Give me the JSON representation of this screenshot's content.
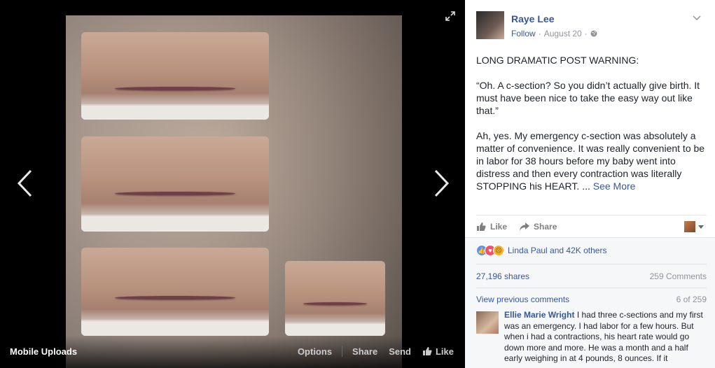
{
  "viewer": {
    "album_name": "Mobile Uploads",
    "actions": {
      "options": "Options",
      "share": "Share",
      "send": "Send",
      "like": "Like"
    }
  },
  "post": {
    "author": "Raye Lee",
    "follow": "Follow",
    "date": "August 20",
    "separator": "·",
    "paragraphs": [
      "LONG DRAMATIC POST WARNING:",
      "“Oh. A c-section? So you didn’t actually give birth. It must have been nice to take the easy way out like that.”"
    ],
    "last_paragraph": "Ah, yes. My emergency c-section was absolutely a matter of convenience. It was really convenient to be in labor for 38 hours before my baby went into distress and then every contraction was literally STOPPING his HEART. ...",
    "see_more": "See More",
    "actions": {
      "like": "Like",
      "share": "Share"
    }
  },
  "social": {
    "reactors": "Linda Paul and 42K others",
    "shares": "27,196 shares",
    "comments": "259 Comments",
    "view_previous": "View previous comments",
    "page_count": "6 of 259"
  },
  "comment": {
    "name": "Ellie Marie Wright",
    "text": "I had three c-sections and my first was an emergency. I had labor for a few hours. But when i had a contractions, his heart rate would go down more and more. He was a month and a half early weighing in at 4 pounds, 8 ounces. If it"
  },
  "colors": {
    "link": "#365899",
    "muted": "#90949c",
    "text": "#1d2129"
  }
}
